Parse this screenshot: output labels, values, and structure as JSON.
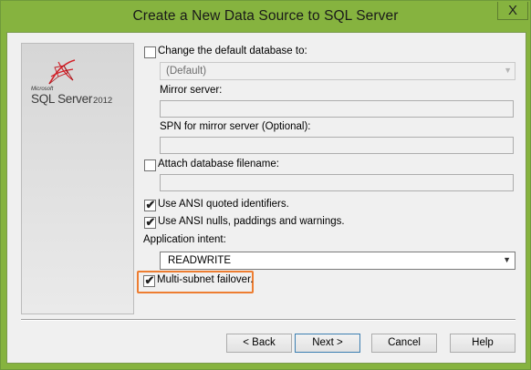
{
  "window": {
    "title": "Create a New Data Source to SQL Server",
    "close_glyph": "X"
  },
  "logo": {
    "brand": "Microsoft",
    "product": "SQL Server",
    "version": "2012"
  },
  "form": {
    "change_db": {
      "label": "Change the default database to:",
      "checked": false,
      "value": "(Default)"
    },
    "mirror_server": {
      "label": "Mirror server:",
      "value": ""
    },
    "spn": {
      "label": "SPN for mirror server (Optional):",
      "value": ""
    },
    "attach_db": {
      "label": "Attach database filename:",
      "checked": false,
      "value": ""
    },
    "ansi_quoted": {
      "label": "Use ANSI quoted identifiers.",
      "checked": true
    },
    "ansi_nulls": {
      "label": "Use ANSI nulls, paddings and warnings.",
      "checked": true
    },
    "app_intent": {
      "label": "Application intent:",
      "value": "READWRITE"
    },
    "multi_subnet": {
      "label": "Multi-subnet failover.",
      "checked": true
    },
    "check_glyph": "✔",
    "dropdown_glyph": "▼"
  },
  "buttons": {
    "back": "< Back",
    "next": "Next >",
    "cancel": "Cancel",
    "help": "Help"
  },
  "colors": {
    "frame": "#86b33f",
    "highlight": "#ed7d31",
    "dialog_bg": "#f0f0f0"
  }
}
